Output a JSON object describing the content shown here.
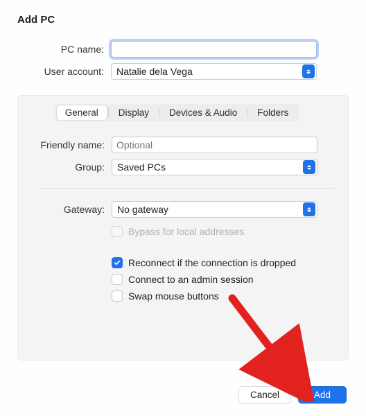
{
  "title": "Add PC",
  "fields": {
    "pc_name_label": "PC name:",
    "pc_name_value": "",
    "user_account_label": "User account:",
    "user_account_value": "Natalie dela Vega"
  },
  "tabs": {
    "general": "General",
    "display": "Display",
    "devices": "Devices & Audio",
    "folders": "Folders"
  },
  "panel": {
    "friendly_name_label": "Friendly name:",
    "friendly_name_placeholder": "Optional",
    "friendly_name_value": "",
    "group_label": "Group:",
    "group_value": "Saved PCs",
    "gateway_label": "Gateway:",
    "gateway_value": "No gateway",
    "bypass_label": "Bypass for local addresses",
    "bypass_checked": false,
    "bypass_disabled": true,
    "reconnect_label": "Reconnect if the connection is dropped",
    "reconnect_checked": true,
    "admin_label": "Connect to an admin session",
    "admin_checked": false,
    "swap_label": "Swap mouse buttons",
    "swap_checked": false
  },
  "footer": {
    "cancel_label": "Cancel",
    "add_label": "Add"
  }
}
